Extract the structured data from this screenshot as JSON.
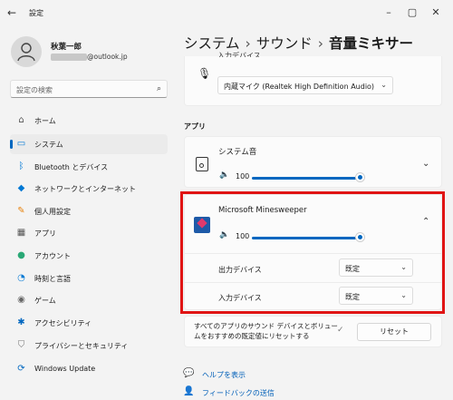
{
  "titlebar": {
    "app_title": "設定",
    "back_icon": "back-arrow-icon"
  },
  "account": {
    "name": "秋葉一郎",
    "email_suffix": "@outlook.jp"
  },
  "search": {
    "placeholder": "設定の検索"
  },
  "nav": [
    {
      "label": "ホーム",
      "icon": "home-icon",
      "glyph": "⌂",
      "color": "#555555",
      "active": false
    },
    {
      "label": "システム",
      "icon": "system-icon",
      "glyph": "▭",
      "color": "#0078d4",
      "active": true
    },
    {
      "label": "Bluetooth とデバイス",
      "icon": "bluetooth-icon",
      "glyph": "ᛒ",
      "color": "#0078d4",
      "active": false
    },
    {
      "label": "ネットワークとインターネット",
      "icon": "network-icon",
      "glyph": "◆",
      "color": "#0078d4",
      "active": false
    },
    {
      "label": "個人用設定",
      "icon": "brush-icon",
      "glyph": "✎",
      "color": "#e8820c",
      "active": false
    },
    {
      "label": "アプリ",
      "icon": "apps-icon",
      "glyph": "▦",
      "color": "#555555",
      "active": false
    },
    {
      "label": "アカウント",
      "icon": "account-icon",
      "glyph": "●",
      "color": "#2aa876",
      "active": false
    },
    {
      "label": "時刻と言語",
      "icon": "globe-clock-icon",
      "glyph": "◔",
      "color": "#0078d4",
      "active": false
    },
    {
      "label": "ゲーム",
      "icon": "gamepad-icon",
      "glyph": "◉",
      "color": "#666666",
      "active": false
    },
    {
      "label": "アクセシビリティ",
      "icon": "accessibility-icon",
      "glyph": "✱",
      "color": "#0067c0",
      "active": false
    },
    {
      "label": "プライバシーとセキュリティ",
      "icon": "shield-icon",
      "glyph": "⛉",
      "color": "#777777",
      "active": false
    },
    {
      "label": "Windows Update",
      "icon": "update-icon",
      "glyph": "⟳",
      "color": "#0067c0",
      "active": false
    }
  ],
  "breadcrumb": {
    "part1": "システム",
    "sep1": "›",
    "part2": "サウンド",
    "sep2": "›",
    "current": "音量ミキサー"
  },
  "input_device_row": {
    "label_partial": "入力デバイス",
    "value": "内蔵マイク (Realtek High Definition Audio)"
  },
  "apps_section": {
    "label": "アプリ"
  },
  "system_sounds": {
    "name": "システム音",
    "volume": "100",
    "volume_level": 1.0
  },
  "minesweeper": {
    "name": "Microsoft Minesweeper",
    "volume": "100",
    "volume_level": 1.0,
    "output_label": "出力デバイス",
    "output_value": "既定",
    "input_label": "入力デバイス",
    "input_value": "既定"
  },
  "reset_row": {
    "text_line1": "すべてのアプリのサウンド デバイスとボリュー",
    "text_line2": "ムをおすすめの既定値にリセットする",
    "button": "リセット"
  },
  "links": {
    "help": "ヘルプを表示",
    "feedback": "フィードバックの送信"
  },
  "colors": {
    "accent": "#0067c0",
    "highlight": "#e01414"
  }
}
